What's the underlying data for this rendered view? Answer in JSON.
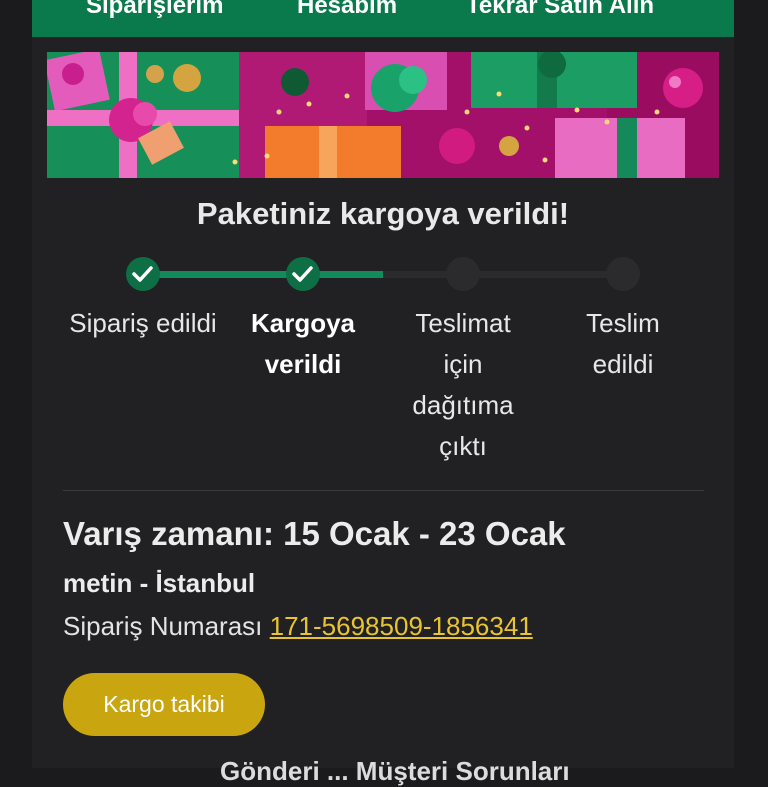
{
  "nav": {
    "orders": "Siparişlerim",
    "account": "Hesabım",
    "buy_again": "Tekrar Satın Alın"
  },
  "shipment": {
    "headline": "Paketiniz kargoya verildi!",
    "progress_completed_steps": 2,
    "steps": [
      {
        "label": "Sipariş edildi",
        "state": "done"
      },
      {
        "label": "Kargoya verildi",
        "state": "current"
      },
      {
        "label": "Teslimat için dağıtıma çıktı",
        "state": "pending"
      },
      {
        "label": "Teslim edildi",
        "state": "pending"
      }
    ]
  },
  "details": {
    "arrival": "Varış zamanı: 15 Ocak - 23 Ocak",
    "recipient": "metin - İstanbul",
    "order_label": "Sipariş Numarası",
    "order_number": "171-5698509-1856341"
  },
  "actions": {
    "track_label": "Kargo takibi"
  },
  "footer": {
    "cutoff_text": "Gönderi ... Müşteri Sorunları"
  },
  "colors": {
    "brand_green": "#0a7a4c",
    "progress_green": "#138a5a",
    "accent_yellow": "#c9a510",
    "link_yellow": "#e9c431"
  }
}
